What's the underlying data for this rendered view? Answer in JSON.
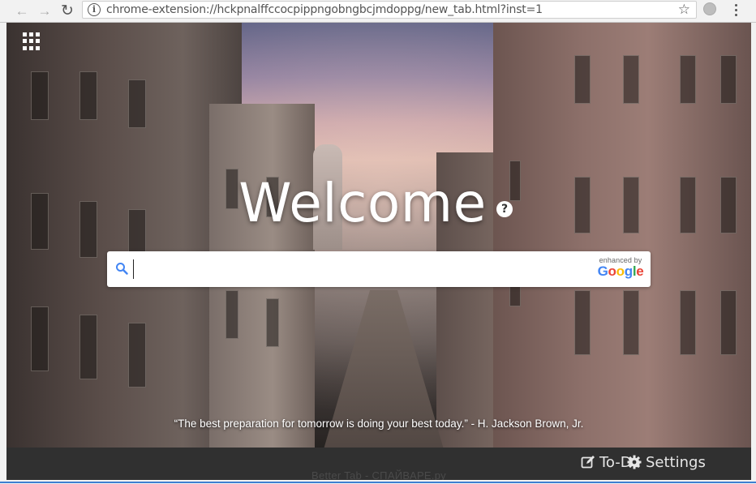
{
  "browser": {
    "url": "chrome-extension://hckpnalffccocpippngobngbcjmdoppg/new_tab.html?inst=1",
    "back_icon": "arrow-left",
    "forward_icon": "arrow-right",
    "reload_icon": "reload",
    "star_icon": "star",
    "menu_icon": "vertical-dots"
  },
  "newtab": {
    "apps_icon": "grid",
    "welcome": "Welcome",
    "help_glyph": "?",
    "search": {
      "value": "",
      "placeholder": "",
      "enhanced_label": "enhanced by",
      "google_letters": [
        "G",
        "o",
        "o",
        "g",
        "l",
        "e"
      ],
      "google_colors": [
        "#4285F4",
        "#EA4335",
        "#FBBC05",
        "#4285F4",
        "#34A853",
        "#EA4335"
      ]
    },
    "quote": "“The best preparation for tomorrow is doing your best today.” - H. Jackson Brown, Jr.",
    "todo_label": "To-Do",
    "settings_label": "Settings",
    "footer": "Better Tab - СПАЙВАРЕ.ру"
  }
}
